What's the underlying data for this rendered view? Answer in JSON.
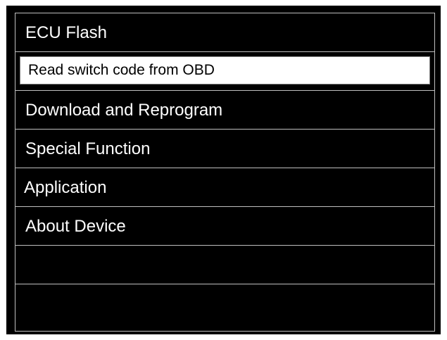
{
  "menu": {
    "title": "ECU Flash",
    "items": [
      {
        "label": "Read switch code from OBD",
        "selected": true
      },
      {
        "label": "Download and Reprogram",
        "selected": false
      },
      {
        "label": "Special Function",
        "selected": false
      },
      {
        "label": "Application",
        "selected": false
      },
      {
        "label": "About Device",
        "selected": false
      },
      {
        "label": "",
        "selected": false
      },
      {
        "label": "",
        "selected": false
      }
    ]
  },
  "colors": {
    "background": "#000000",
    "text": "#ffffff",
    "selection_background": "#ffffff",
    "selection_text": "#000000",
    "divider": "#bfbfbf"
  }
}
